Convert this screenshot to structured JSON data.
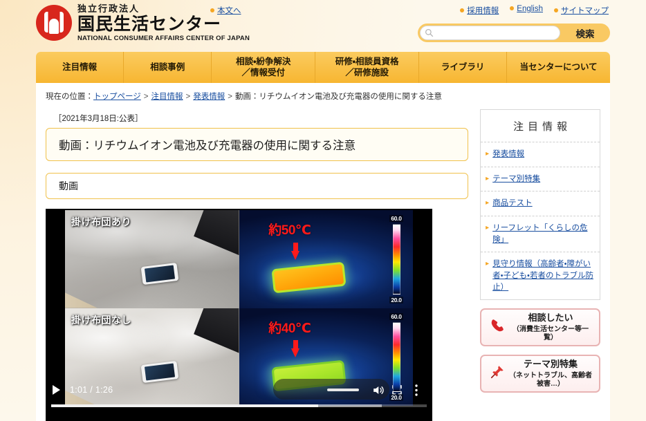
{
  "header": {
    "logo": {
      "sub_ja": "独立行政法人",
      "main_ja": "国民生活センター",
      "en": "NATIONAL CONSUMER AFFAIRS CENTER OF JAPAN",
      "mark_color": "#d8261c"
    },
    "skip_link": "本文へ",
    "util_links": [
      {
        "label": "採用情報"
      },
      {
        "label": "English"
      },
      {
        "label": "サイトマップ"
      }
    ],
    "search": {
      "value": "",
      "placeholder": "",
      "button_label": "検索",
      "icon": "search-icon"
    }
  },
  "gnav": [
    {
      "label": "注目情報"
    },
    {
      "label": "相談事例"
    },
    {
      "label": "相談・紛争解決\n／情報受付"
    },
    {
      "label": "研修・相談員資格\n／研修施設"
    },
    {
      "label": "ライブラリ"
    },
    {
      "label": "当センターについて"
    }
  ],
  "breadcrumb": {
    "prefix": "現在の位置：",
    "items": [
      {
        "label": "トップページ",
        "link": true
      },
      {
        "label": "注目情報",
        "link": true
      },
      {
        "label": "発表情報",
        "link": true
      },
      {
        "label": "動画：リチウムイオン電池及び充電器の使用に関する注意",
        "link": false
      }
    ],
    "separator": ">"
  },
  "main": {
    "pub_date": "［2021年3月18日:公表］",
    "title": "動画：リチウムイオン電池及び充電器の使用に関する注意",
    "section_heading": "動画",
    "player": {
      "current_time": "1:01",
      "duration": "1:26",
      "time_display": "1:01 / 1:26",
      "progress_percent": 71,
      "buffered_percent": 88,
      "volume_percent": 100,
      "play_icon": "play-icon",
      "volume_icon": "volume-icon",
      "fullscreen_icon": "fullscreen-icon",
      "more_icon": "kebab-menu-icon",
      "panels": [
        {
          "caption": "掛け布団あり",
          "type": "photo"
        },
        {
          "type": "thermal",
          "temperature_label": "約50℃",
          "scale_max": "60.0",
          "scale_min": "20.0",
          "state": "hot"
        },
        {
          "caption": "掛け布団なし",
          "type": "photo"
        },
        {
          "type": "thermal",
          "temperature_label": "約40℃",
          "scale_max": "60.0",
          "scale_min": "20.0",
          "state": "warm"
        }
      ]
    }
  },
  "sidebar": {
    "title": "注目情報",
    "links": [
      {
        "label": "発表情報"
      },
      {
        "label": "テーマ別特集"
      },
      {
        "label": "商品テスト"
      },
      {
        "label": "リーフレット「くらしの危険」"
      },
      {
        "label": "見守り情報（高齢者・障がい者・子ども・若者のトラブル防止）"
      }
    ],
    "banners": [
      {
        "icon": "phone-icon",
        "main": "相談したい",
        "sub": "（消費生活センター等一覧）"
      },
      {
        "icon": "pushpin-icon",
        "main": "テーマ別特集",
        "sub": "（ネットトラブル、高齢者被害…）"
      }
    ]
  },
  "colors": {
    "brand_orange": "#f7b631",
    "brand_red": "#d8261c",
    "link_blue": "#1a4fa0",
    "thermal_red": "#ff1a1a"
  }
}
